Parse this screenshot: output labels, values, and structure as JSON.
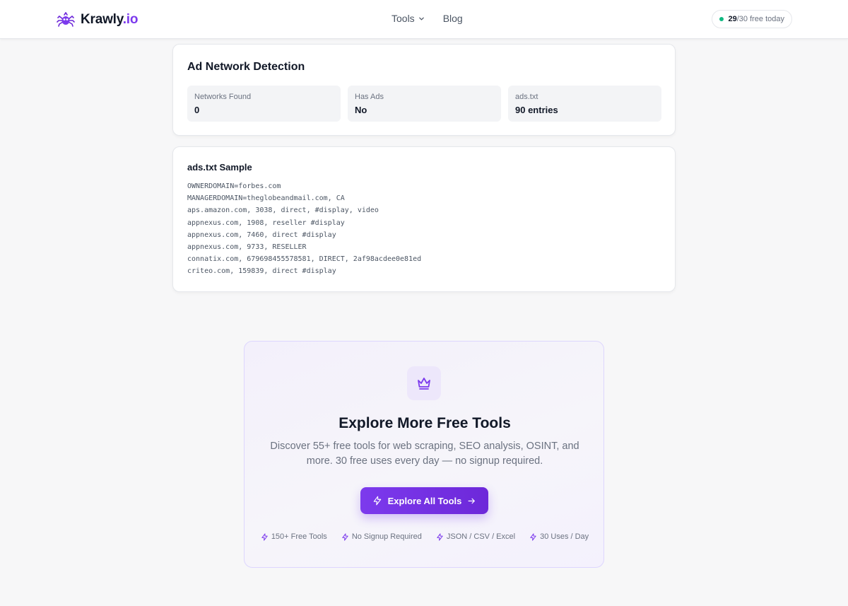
{
  "header": {
    "logo_name": "Krawly",
    "logo_tld": ".io",
    "nav": {
      "tools_label": "Tools",
      "blog_label": "Blog"
    },
    "usage": {
      "used": "29",
      "rest": "/30 free today"
    }
  },
  "detection": {
    "title": "Ad Network Detection",
    "stats": [
      {
        "label": "Networks Found",
        "value": "0"
      },
      {
        "label": "Has Ads",
        "value": "No"
      },
      {
        "label": "ads.txt",
        "value": "90 entries"
      }
    ]
  },
  "sample": {
    "title": "ads.txt Sample",
    "lines": [
      "OWNERDOMAIN=forbes.com",
      "MANAGERDOMAIN=theglobeandmail.com, CA",
      "aps.amazon.com, 3038, direct, #display, video",
      "appnexus.com, 1908, reseller #display",
      "appnexus.com, 7460, direct #display",
      "appnexus.com, 9733, RESELLER",
      "connatix.com, 679698455578581, DIRECT, 2af98acdee0e81ed",
      "criteo.com, 159839, direct #display"
    ]
  },
  "promo": {
    "icon": "crown-icon",
    "title": "Explore More Free Tools",
    "description": "Discover 55+ free tools for web scraping, SEO analysis, OSINT, and more. 30 free uses every day — no signup required.",
    "cta_label": "Explore All Tools",
    "features": [
      "150+ Free Tools",
      "No Signup Required",
      "JSON / CSV / Excel",
      "30 Uses / Day"
    ]
  },
  "colors": {
    "accent": "#7c3aed",
    "status_dot": "#10b981",
    "background": "#f7f7f8"
  }
}
